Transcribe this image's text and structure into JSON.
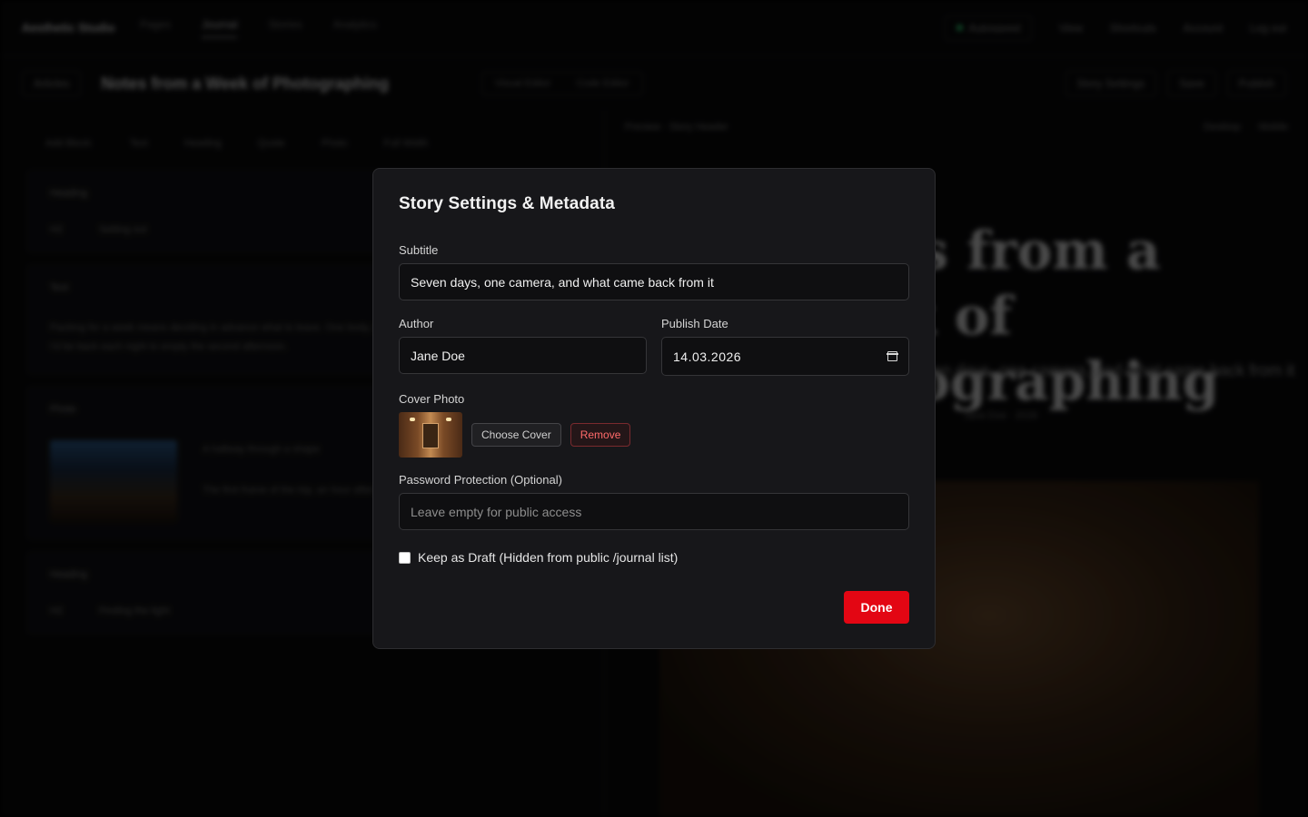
{
  "background": {
    "brand": "Aesthetic Studio",
    "nav": [
      "Pages",
      "Journal",
      "Stories",
      "Analytics"
    ],
    "nav_active_index": 1,
    "status": "Autosaved",
    "right_links": [
      "View",
      "Shortcuts",
      "Account",
      "Log out"
    ],
    "editor": {
      "back_label": "Articles",
      "title": "Notes from a Week of Photographing",
      "tabs": [
        "Visual Editor",
        "Code Editor"
      ],
      "actions": [
        "Story Settings",
        "Save",
        "Publish"
      ]
    },
    "block_tabs": [
      "Add Block:",
      "Text",
      "Heading",
      "Quote",
      "Photo",
      "Full Width"
    ],
    "cards": [
      {
        "title": "Heading",
        "row": [
          "H2",
          "Setting out"
        ]
      },
      {
        "title": "Text",
        "body": "Packing for a week means deciding in advance what to leave. One body, two lenses, and the quiet certainty that I'd be back each night to empty the second afternoon."
      },
      {
        "title": "Photo",
        "caption": "A hallway through a shape",
        "note": "The first frame of the trip, an hour after sunrise."
      },
      {
        "title": "Heading",
        "row": [
          "H2",
          "Finding the light"
        ]
      }
    ],
    "preview": {
      "label": "Preview · Story Header",
      "modes": [
        "Desktop",
        "Mobile"
      ],
      "title": "Notes from a Week of Photographing",
      "subtitle": "Seven days, one camera, and what came back from it",
      "meta": "Jane Doe · 2026"
    }
  },
  "modal": {
    "title": "Story Settings & Metadata",
    "subtitle_label": "Subtitle",
    "subtitle_value": "Seven days, one camera, and what came back from it",
    "author_label": "Author",
    "author_value": "Jane Doe",
    "date_label": "Publish Date",
    "date_value": "14.03.2026",
    "cover_label": "Cover Photo",
    "choose_label": "Choose Cover",
    "remove_label": "Remove",
    "password_label": "Password Protection (Optional)",
    "password_placeholder": "Leave empty for public access",
    "draft_label": "Keep as Draft (Hidden from public /journal list)",
    "draft_checked": false,
    "done_label": "Done",
    "colors": {
      "accent": "#e30613",
      "danger_text": "#ff6a6a",
      "panel": "#17171a"
    }
  }
}
